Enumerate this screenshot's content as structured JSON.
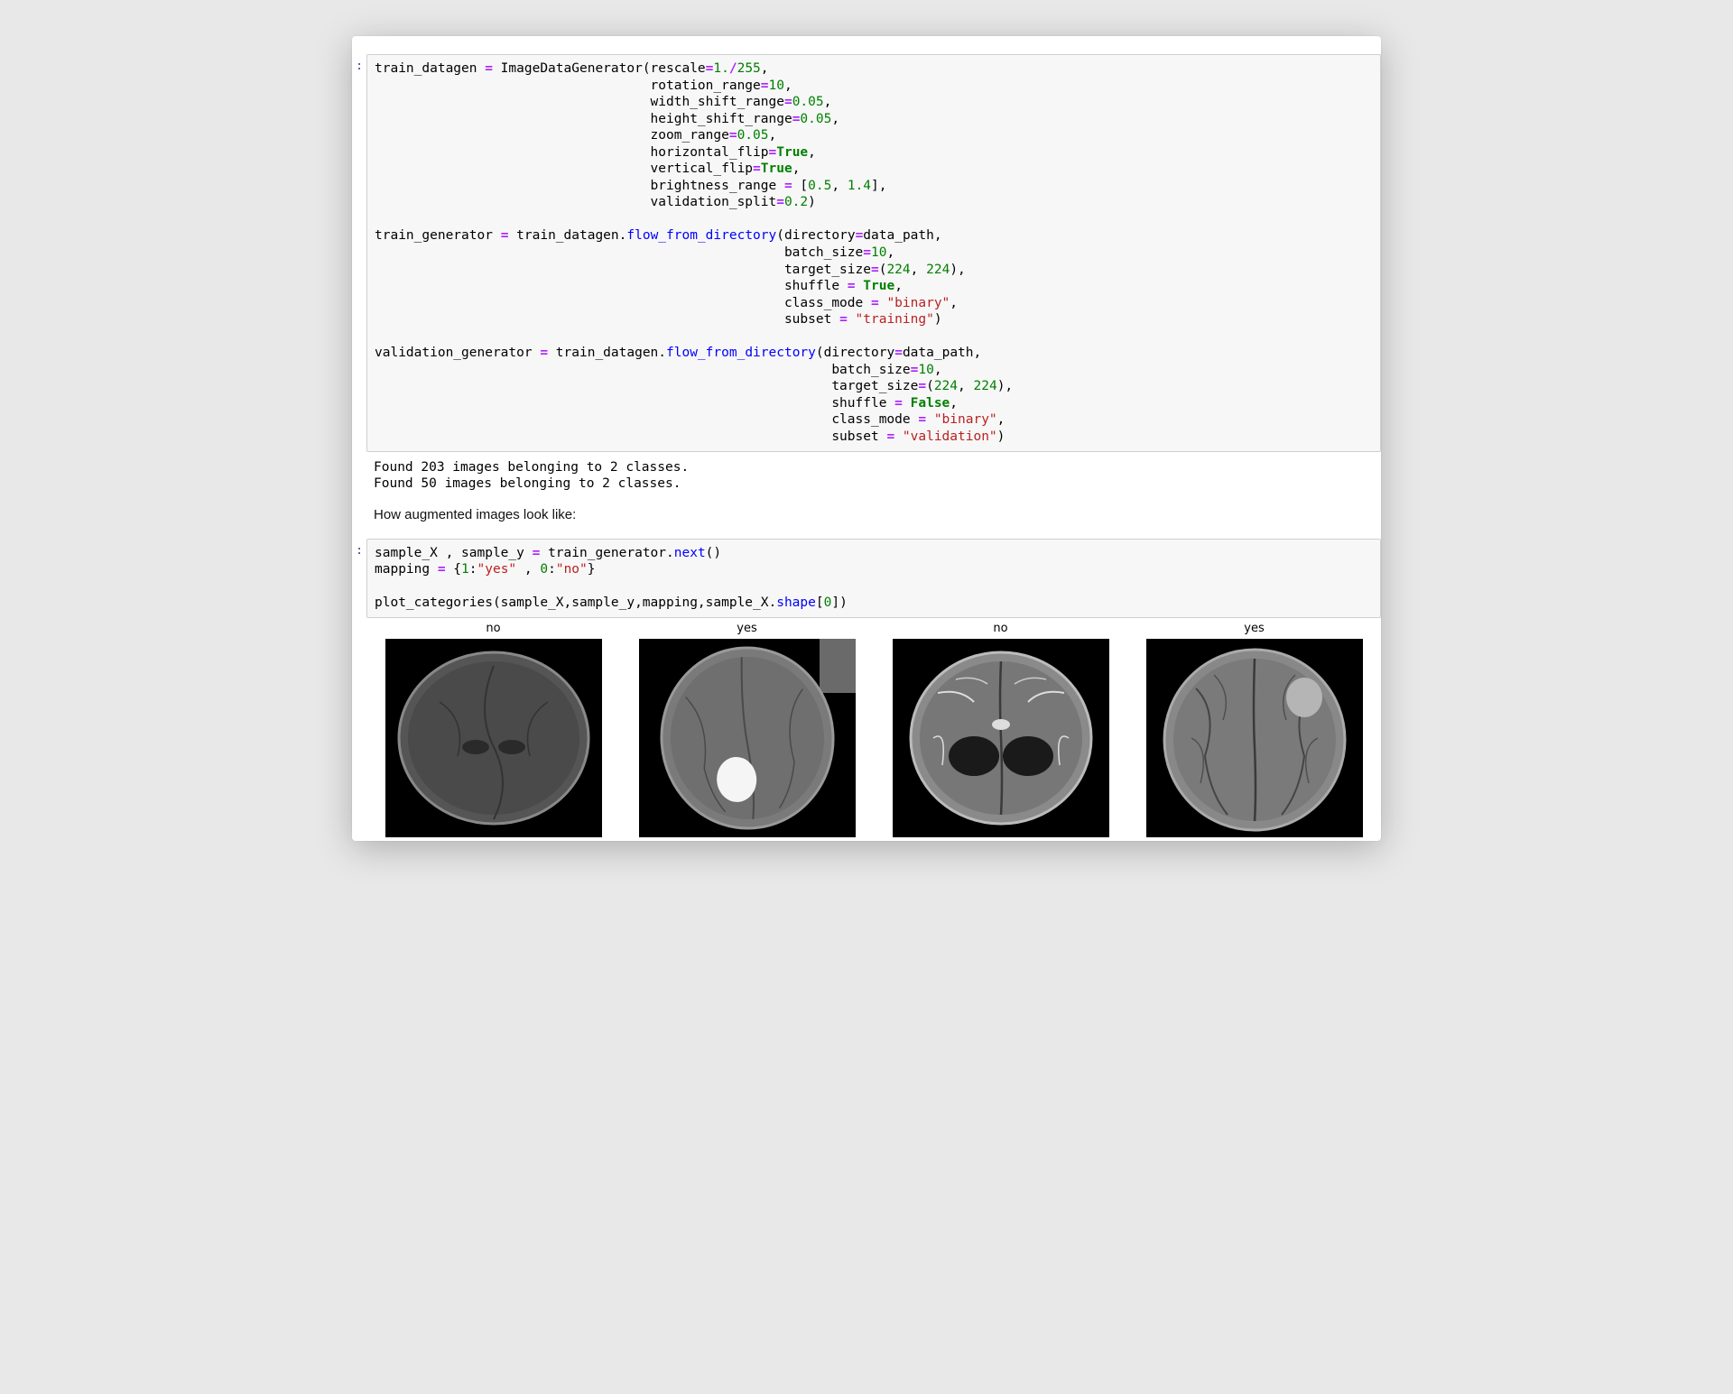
{
  "cells": {
    "code1_tokens": [
      {
        "text": "train_datagen ",
        "cls": ""
      },
      {
        "text": "=",
        "cls": "tok-op"
      },
      {
        "text": " ImageDataGenerator(rescale",
        "cls": ""
      },
      {
        "text": "=",
        "cls": "tok-op"
      },
      {
        "text": "1.",
        "cls": "tok-num"
      },
      {
        "text": "/",
        "cls": "tok-op"
      },
      {
        "text": "255",
        "cls": "tok-num"
      },
      {
        "text": ",\n                                   rotation_range",
        "cls": ""
      },
      {
        "text": "=",
        "cls": "tok-op"
      },
      {
        "text": "10",
        "cls": "tok-num"
      },
      {
        "text": ",\n                                   width_shift_range",
        "cls": ""
      },
      {
        "text": "=",
        "cls": "tok-op"
      },
      {
        "text": "0.05",
        "cls": "tok-num"
      },
      {
        "text": ",\n                                   height_shift_range",
        "cls": ""
      },
      {
        "text": "=",
        "cls": "tok-op"
      },
      {
        "text": "0.05",
        "cls": "tok-num"
      },
      {
        "text": ",\n                                   zoom_range",
        "cls": ""
      },
      {
        "text": "=",
        "cls": "tok-op"
      },
      {
        "text": "0.05",
        "cls": "tok-num"
      },
      {
        "text": ",\n                                   horizontal_flip",
        "cls": ""
      },
      {
        "text": "=",
        "cls": "tok-op"
      },
      {
        "text": "True",
        "cls": "tok-kw"
      },
      {
        "text": ",\n                                   vertical_flip",
        "cls": ""
      },
      {
        "text": "=",
        "cls": "tok-op"
      },
      {
        "text": "True",
        "cls": "tok-kw"
      },
      {
        "text": ",\n                                   brightness_range ",
        "cls": ""
      },
      {
        "text": "=",
        "cls": "tok-op"
      },
      {
        "text": " [",
        "cls": ""
      },
      {
        "text": "0.5",
        "cls": "tok-num"
      },
      {
        "text": ", ",
        "cls": ""
      },
      {
        "text": "1.4",
        "cls": "tok-num"
      },
      {
        "text": "],\n                                   validation_split",
        "cls": ""
      },
      {
        "text": "=",
        "cls": "tok-op"
      },
      {
        "text": "0.2",
        "cls": "tok-num"
      },
      {
        "text": ")\n\ntrain_generator ",
        "cls": ""
      },
      {
        "text": "=",
        "cls": "tok-op"
      },
      {
        "text": " train_datagen.",
        "cls": ""
      },
      {
        "text": "flow_from_directory",
        "cls": "tok-fn"
      },
      {
        "text": "(directory",
        "cls": ""
      },
      {
        "text": "=",
        "cls": "tok-op"
      },
      {
        "text": "data_path,\n                                                    batch_size",
        "cls": ""
      },
      {
        "text": "=",
        "cls": "tok-op"
      },
      {
        "text": "10",
        "cls": "tok-num"
      },
      {
        "text": ",\n                                                    target_size",
        "cls": ""
      },
      {
        "text": "=",
        "cls": "tok-op"
      },
      {
        "text": "(",
        "cls": ""
      },
      {
        "text": "224",
        "cls": "tok-num"
      },
      {
        "text": ", ",
        "cls": ""
      },
      {
        "text": "224",
        "cls": "tok-num"
      },
      {
        "text": "),\n                                                    shuffle ",
        "cls": ""
      },
      {
        "text": "=",
        "cls": "tok-op"
      },
      {
        "text": " ",
        "cls": ""
      },
      {
        "text": "True",
        "cls": "tok-kw"
      },
      {
        "text": ",\n                                                    class_mode ",
        "cls": ""
      },
      {
        "text": "=",
        "cls": "tok-op"
      },
      {
        "text": " ",
        "cls": ""
      },
      {
        "text": "\"binary\"",
        "cls": "tok-str"
      },
      {
        "text": ",\n                                                    subset ",
        "cls": ""
      },
      {
        "text": "=",
        "cls": "tok-op"
      },
      {
        "text": " ",
        "cls": ""
      },
      {
        "text": "\"training\"",
        "cls": "tok-str"
      },
      {
        "text": ")\n\nvalidation_generator ",
        "cls": ""
      },
      {
        "text": "=",
        "cls": "tok-op"
      },
      {
        "text": " train_datagen.",
        "cls": ""
      },
      {
        "text": "flow_from_directory",
        "cls": "tok-fn"
      },
      {
        "text": "(directory",
        "cls": ""
      },
      {
        "text": "=",
        "cls": "tok-op"
      },
      {
        "text": "data_path,\n                                                          batch_size",
        "cls": ""
      },
      {
        "text": "=",
        "cls": "tok-op"
      },
      {
        "text": "10",
        "cls": "tok-num"
      },
      {
        "text": ",\n                                                          target_size",
        "cls": ""
      },
      {
        "text": "=",
        "cls": "tok-op"
      },
      {
        "text": "(",
        "cls": ""
      },
      {
        "text": "224",
        "cls": "tok-num"
      },
      {
        "text": ", ",
        "cls": ""
      },
      {
        "text": "224",
        "cls": "tok-num"
      },
      {
        "text": "),\n                                                          shuffle ",
        "cls": ""
      },
      {
        "text": "=",
        "cls": "tok-op"
      },
      {
        "text": " ",
        "cls": ""
      },
      {
        "text": "False",
        "cls": "tok-kw"
      },
      {
        "text": ",\n                                                          class_mode ",
        "cls": ""
      },
      {
        "text": "=",
        "cls": "tok-op"
      },
      {
        "text": " ",
        "cls": ""
      },
      {
        "text": "\"binary\"",
        "cls": "tok-str"
      },
      {
        "text": ",\n                                                          subset ",
        "cls": ""
      },
      {
        "text": "=",
        "cls": "tok-op"
      },
      {
        "text": " ",
        "cls": ""
      },
      {
        "text": "\"validation\"",
        "cls": "tok-str"
      },
      {
        "text": ")",
        "cls": ""
      }
    ],
    "output1": "Found 203 images belonging to 2 classes.\nFound 50 images belonging to 2 classes.",
    "markdown1": "How augmented images look like:",
    "code2_tokens": [
      {
        "text": "sample_X , sample_y ",
        "cls": ""
      },
      {
        "text": "=",
        "cls": "tok-op"
      },
      {
        "text": " train_generator.",
        "cls": ""
      },
      {
        "text": "next",
        "cls": "tok-fn"
      },
      {
        "text": "()\nmapping ",
        "cls": ""
      },
      {
        "text": "=",
        "cls": "tok-op"
      },
      {
        "text": " {",
        "cls": ""
      },
      {
        "text": "1",
        "cls": "tok-num"
      },
      {
        "text": ":",
        "cls": ""
      },
      {
        "text": "\"yes\"",
        "cls": "tok-str"
      },
      {
        "text": " , ",
        "cls": ""
      },
      {
        "text": "0",
        "cls": "tok-num"
      },
      {
        "text": ":",
        "cls": ""
      },
      {
        "text": "\"no\"",
        "cls": "tok-str"
      },
      {
        "text": "}\n\nplot_categories(sample_X,sample_y,mapping,sample_X.",
        "cls": ""
      },
      {
        "text": "shape",
        "cls": "tok-fn"
      },
      {
        "text": "[",
        "cls": ""
      },
      {
        "text": "0",
        "cls": "tok-num"
      },
      {
        "text": "])",
        "cls": ""
      }
    ]
  },
  "images": {
    "titles": [
      "no",
      "yes",
      "no",
      "yes"
    ]
  },
  "prompt_marker": ":"
}
